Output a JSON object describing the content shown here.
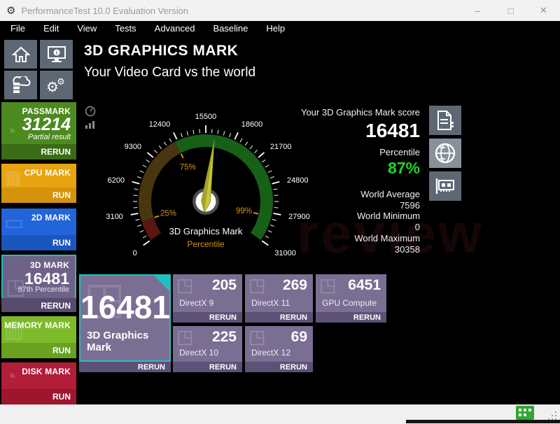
{
  "window": {
    "title": "PerformanceTest 10.0 Evaluation Version",
    "controls": {
      "minimize": "–",
      "maximize": "□",
      "close": "✕"
    }
  },
  "menu": {
    "items": [
      "File",
      "Edit",
      "View",
      "Tests",
      "Advanced",
      "Baseline",
      "Help"
    ]
  },
  "header": {
    "title": "3D GRAPHICS MARK",
    "subtitle": "Your Video Card vs the world"
  },
  "sidebar": {
    "tiles": [
      {
        "id": "passmark",
        "label": "PASSMARK",
        "value": "31214",
        "note": "Partial result",
        "action": "RERUN"
      },
      {
        "id": "cpu-mark",
        "label": "CPU MARK",
        "action": "RUN"
      },
      {
        "id": "2d-mark",
        "label": "2D MARK",
        "action": "RUN"
      },
      {
        "id": "3d-mark",
        "label": "3D MARK",
        "value": "16481",
        "note": "87th Percentile",
        "action": "RERUN",
        "selected": true
      },
      {
        "id": "memory-mark",
        "label": "MEMORY MARK",
        "action": "RUN"
      },
      {
        "id": "disk-mark",
        "label": "DISK MARK",
        "action": "RUN"
      }
    ]
  },
  "gauge": {
    "title": "3D Graphics Mark",
    "subtitle": "Percentile",
    "min": 0,
    "max": 31000,
    "value": 16481,
    "major_step": 3100,
    "minor_step": 620,
    "tick_labels": [
      "0",
      "3100",
      "6200",
      "9300",
      "12400",
      "15500",
      "18600",
      "21700",
      "24800",
      "27900",
      "31000"
    ],
    "segments": [
      {
        "from": 0,
        "to": 2200,
        "color": "#5a1612"
      },
      {
        "from": 2200,
        "to": 12100,
        "color": "#47360f"
      },
      {
        "from": 12100,
        "to": 31000,
        "color": "#176018"
      }
    ],
    "percentile_marks": [
      {
        "label": "25%",
        "value": 2200
      },
      {
        "label": "75%",
        "value": 12100
      },
      {
        "label": "99%",
        "value": 28300
      }
    ],
    "needle_color": "#c8c838",
    "label_color": "#cf9410"
  },
  "score_panel": {
    "heading": "Your 3D Graphics Mark score",
    "score": "16481",
    "percentile_label": "Percentile",
    "percentile": "87%",
    "stats": [
      {
        "label": "World Average",
        "value": "7596"
      },
      {
        "label": "World Minimum",
        "value": "0"
      },
      {
        "label": "World Maximum",
        "value": "30358"
      }
    ]
  },
  "results": {
    "main": {
      "value": "16481",
      "label": "3D Graphics Mark",
      "action": "RERUN"
    },
    "tiles": [
      {
        "label": "DirectX 9",
        "value": "205",
        "action": "RERUN"
      },
      {
        "label": "DirectX 11",
        "value": "269",
        "action": "RERUN"
      },
      {
        "label": "GPU Compute",
        "value": "6451",
        "action": "RERUN"
      },
      {
        "label": "DirectX 10",
        "value": "225",
        "action": "RERUN"
      },
      {
        "label": "DirectX 12",
        "value": "69",
        "action": "RERUN"
      }
    ]
  },
  "watermark": "review",
  "colors": {
    "accent_teal": "#1fc0c0",
    "score_green": "#1fd428",
    "gauge_gold": "#cf9410",
    "passmark_green": "#4c8a20",
    "cpu_orange": "#e8a410",
    "mark2d_blue": "#2264da",
    "mark3d_purple": "#6e6288",
    "memory_green": "#7cba2a",
    "disk_red": "#b21d37",
    "result_tile_purple": "#7b6e93"
  }
}
